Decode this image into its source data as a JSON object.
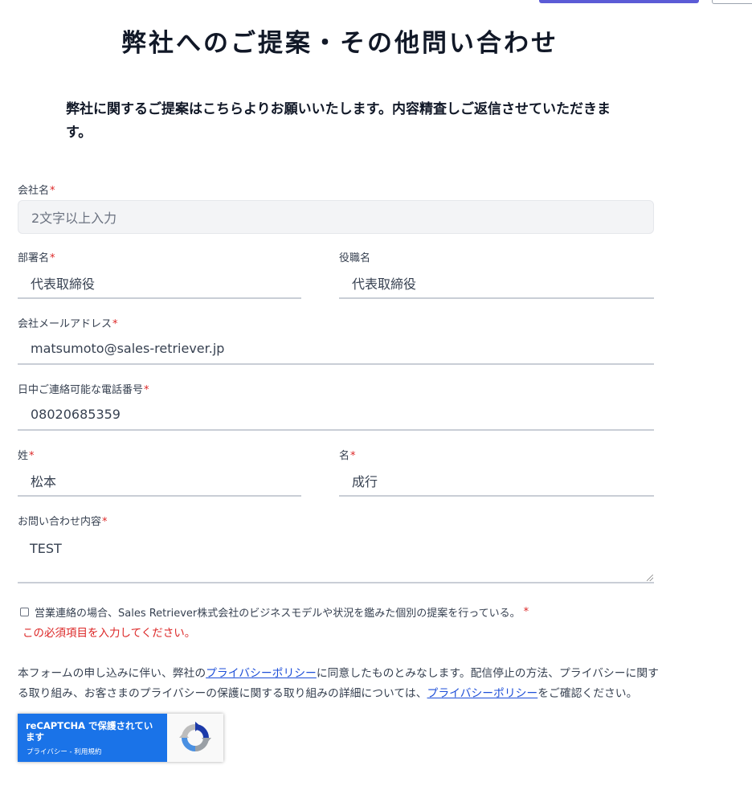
{
  "page": {
    "title": "弊社へのご提案・その他問い合わせ",
    "intro": "弊社に関するご提案はこちらよりお願いいたします。内容精査しご返信させていただきます。"
  },
  "form": {
    "required_mark": "*",
    "company": {
      "label": "会社名",
      "placeholder": "2文字以上入力",
      "value": ""
    },
    "department": {
      "label": "部署名",
      "value": "代表取締役"
    },
    "position": {
      "label": "役職名",
      "value": "代表取締役"
    },
    "email": {
      "label": "会社メールアドレス",
      "value": "matsumoto@sales-retriever.jp"
    },
    "phone": {
      "label": "日中ご連絡可能な電話番号",
      "value": "08020685359"
    },
    "last_name": {
      "label": "姓",
      "value": "松本"
    },
    "first_name": {
      "label": "名",
      "value": "成行"
    },
    "message": {
      "label": "お問い合わせ内容",
      "value": "TEST"
    },
    "consent": {
      "label": "営業連絡の場合、Sales Retriever株式会社のビジネスモデルや状況を鑑みた個別の提案を行っている。",
      "checked": false,
      "error": "この必須項目を入力してください。"
    }
  },
  "policy": {
    "text_1": "本フォームの申し込みに伴い、弊社の",
    "link_1": "プライバシーポリシー",
    "text_2": "に同意したものとみなします。配信停止の方法、プライバシーに関する取り組み、お客さまのプライバシーの保護に関する取り組みの詳細については、",
    "link_2": "プライバシーポリシー",
    "text_3": "をご確認ください。"
  },
  "recaptcha": {
    "main": "reCAPTCHA で保護されています",
    "privacy": "プライバシー",
    "separator": " - ",
    "terms": "利用規約",
    "icon": "recaptcha-logo-icon"
  },
  "colors": {
    "accent": "#5b5bd6",
    "required": "#dc2626",
    "link": "#1d4ed8",
    "recaptcha_blue": "#1a73e8"
  }
}
